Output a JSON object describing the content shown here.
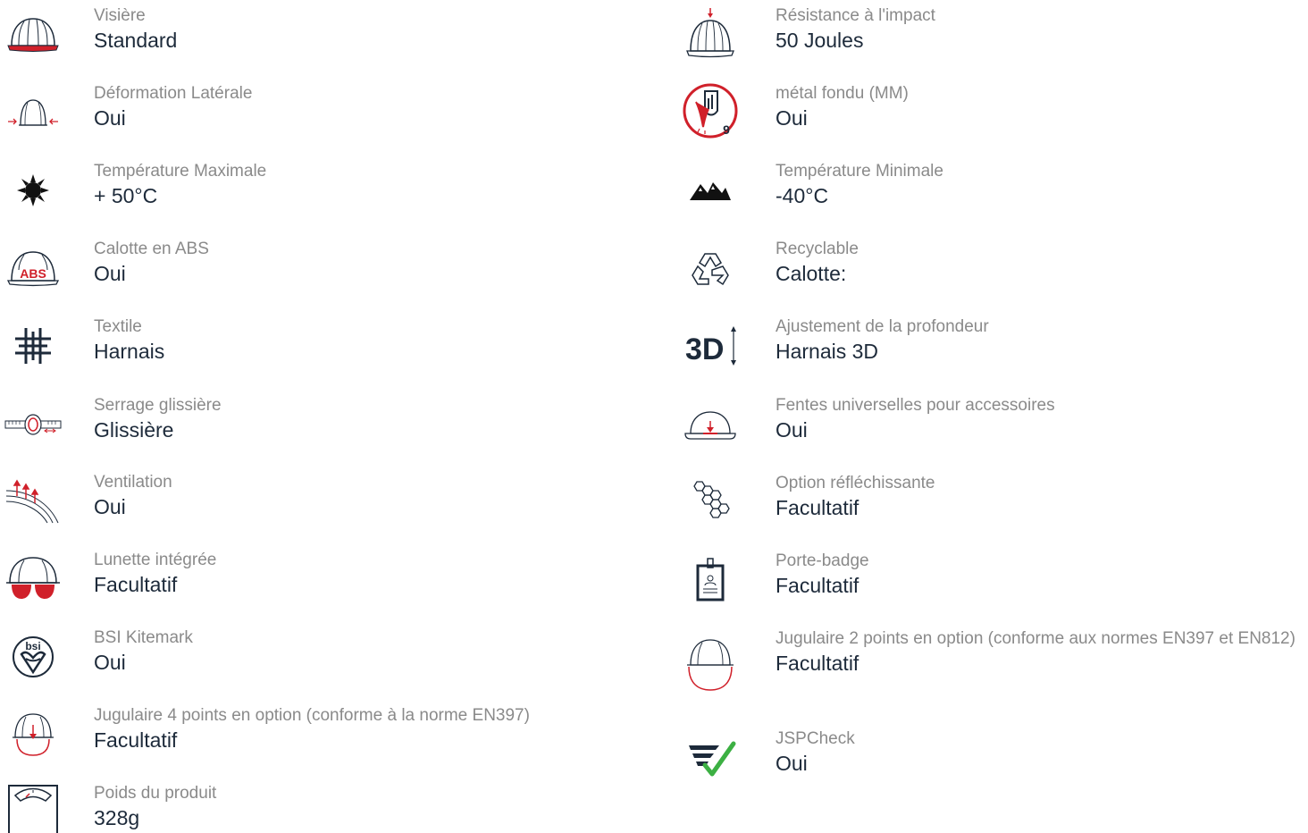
{
  "left_items": [
    {
      "icon": "visor-helmet-icon",
      "label": "Visière",
      "value": "Standard"
    },
    {
      "icon": "lateral-deformation-icon",
      "label": "Déformation Latérale",
      "value": "Oui"
    },
    {
      "icon": "sun-icon",
      "label": "Température Maximale",
      "value": "+ 50°C"
    },
    {
      "icon": "abs-helmet-icon",
      "label": "Calotte en ABS",
      "value": "Oui",
      "icon_text": "ABS"
    },
    {
      "icon": "textile-grid-icon",
      "label": "Textile",
      "value": "Harnais"
    },
    {
      "icon": "slide-adjuster-icon",
      "label": "Serrage glissière",
      "value": "Glissière"
    },
    {
      "icon": "ventilation-icon",
      "label": "Ventilation",
      "value": "Oui"
    },
    {
      "icon": "integrated-goggles-icon",
      "label": "Lunette intégrée",
      "value": "Facultatif"
    },
    {
      "icon": "bsi-kitemark-icon",
      "label": "BSI Kitemark",
      "value": "Oui",
      "icon_text": "bsi"
    },
    {
      "icon": "chinstrap-4pt-icon",
      "label": "Jugulaire 4 points en option (conforme à la norme EN397)",
      "value": "Facultatif"
    },
    {
      "icon": "weight-scale-icon",
      "label": "Poids du produit",
      "value": "328g"
    }
  ],
  "right_items": [
    {
      "icon": "impact-helmet-icon",
      "label": "Résistance à l'impact",
      "value": "50 Joules"
    },
    {
      "icon": "molten-metal-icon",
      "label": "métal fondu (MM)",
      "value": "Oui",
      "icon_text": "9"
    },
    {
      "icon": "mountains-icon",
      "label": "Température Minimale",
      "value": "-40°C"
    },
    {
      "icon": "recycle-icon",
      "label": "Recyclable",
      "value": "Calotte:"
    },
    {
      "icon": "depth-3d-icon",
      "label": "Ajustement de la profondeur",
      "value": "Harnais 3D",
      "icon_text": "3D"
    },
    {
      "icon": "accessory-slot-icon",
      "label": "Fentes universelles pour accessoires",
      "value": "Oui"
    },
    {
      "icon": "hexagon-reflective-icon",
      "label": "Option réfléchissante",
      "value": "Facultatif"
    },
    {
      "icon": "badge-holder-icon",
      "label": "Porte-badge",
      "value": "Facultatif"
    },
    {
      "icon": "chinstrap-2pt-icon",
      "label": "Jugulaire 2 points en option (conforme aux normes EN397 et EN812)",
      "value": "Facultatif"
    },
    {
      "icon": "jspcheck-icon",
      "label": "JSPCheck",
      "value": "Oui"
    }
  ],
  "colors": {
    "accent": "#d0202a",
    "navy": "#1d2a3a",
    "label": "#8a8a8a",
    "check": "#3cb043"
  }
}
